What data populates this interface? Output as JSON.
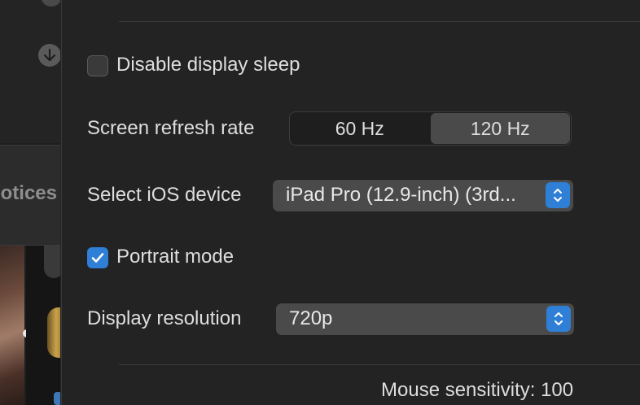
{
  "sidebar": {
    "section_label": "otices"
  },
  "settings": {
    "disable_sleep": {
      "label": "Disable display sleep",
      "checked": false
    },
    "refresh_rate": {
      "label": "Screen refresh rate",
      "options": [
        "60 Hz",
        "120 Hz"
      ],
      "selected": "120 Hz"
    },
    "ios_device": {
      "label": "Select iOS device",
      "value": "iPad Pro (12.9-inch) (3rd..."
    },
    "portrait": {
      "label": "Portrait mode",
      "checked": true
    },
    "resolution": {
      "label": "Display resolution",
      "value": "720p"
    },
    "mouse_sensitivity": {
      "text": "Mouse sensitivity: 100"
    }
  },
  "colors": {
    "accent": "#2f7fd6",
    "panel_bg": "#232323",
    "control_bg": "#4a4a4a"
  },
  "icons": {
    "download": "download-icon",
    "check": "checkmark-icon",
    "stepper": "up-down-chevron-icon"
  }
}
